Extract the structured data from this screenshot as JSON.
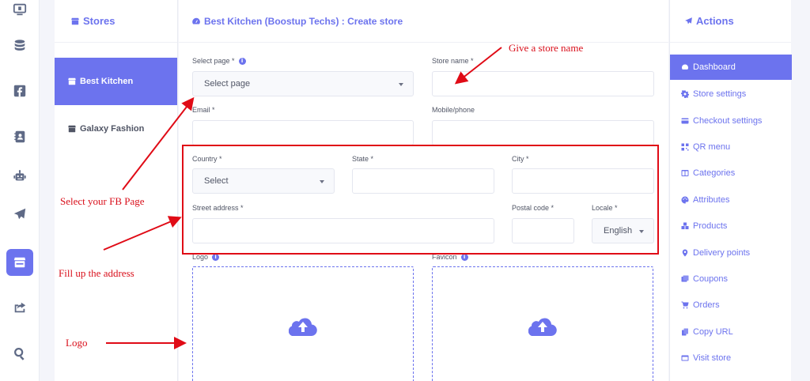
{
  "rail": {
    "items": [
      {
        "icon": "monitor-icon"
      },
      {
        "icon": "database-icon"
      },
      {
        "icon": "facebook-icon"
      },
      {
        "icon": "contact-book-icon"
      },
      {
        "icon": "robot-icon"
      },
      {
        "icon": "paper-plane-icon"
      },
      {
        "icon": "store-icon",
        "active": true
      },
      {
        "icon": "share-icon"
      },
      {
        "icon": "search-icon"
      }
    ]
  },
  "stores": {
    "title": "Stores",
    "items": [
      {
        "label": "Best Kitchen",
        "active": true
      },
      {
        "label": "Galaxy Fashion"
      }
    ]
  },
  "form": {
    "title": "Best Kitchen (Boostup Techs) : Create store",
    "select_page_label": "Select page *",
    "select_page_value": "Select page",
    "store_name_label": "Store name *",
    "store_name_value": "",
    "email_label": "Email *",
    "email_value": "",
    "mobile_label": "Mobile/phone",
    "mobile_value": "",
    "country_label": "Country *",
    "country_value": "Select",
    "state_label": "State *",
    "state_value": "",
    "city_label": "City *",
    "city_value": "",
    "street_label": "Street address *",
    "street_value": "",
    "postal_label": "Postal code *",
    "postal_value": "",
    "locale_label": "Locale *",
    "locale_value": "English",
    "logo_label": "Logo",
    "favicon_label": "Favicon"
  },
  "actions": {
    "title": "Actions",
    "items": [
      {
        "label": "Dashboard",
        "icon": "dashboard-icon",
        "active": true
      },
      {
        "label": "Store settings",
        "icon": "gear-icon"
      },
      {
        "label": "Checkout settings",
        "icon": "credit-card-icon"
      },
      {
        "label": "QR menu",
        "icon": "qr-code-icon"
      },
      {
        "label": "Categories",
        "icon": "columns-icon"
      },
      {
        "label": "Attributes",
        "icon": "palette-icon"
      },
      {
        "label": "Products",
        "icon": "boxes-icon"
      },
      {
        "label": "Delivery points",
        "icon": "map-marker-icon"
      },
      {
        "label": "Coupons",
        "icon": "coupons-icon"
      },
      {
        "label": "Orders",
        "icon": "cart-icon"
      },
      {
        "label": "Copy URL",
        "icon": "copy-icon"
      },
      {
        "label": "Visit store",
        "icon": "window-icon"
      }
    ]
  },
  "annotations": {
    "store_name_note": "Give a store name",
    "fb_page_note": "Select your FB Page",
    "address_note": "Fill up the address",
    "logo_note": "Logo",
    "annotation_color": "#d9101c"
  },
  "colors": {
    "accent": "#6c73ee",
    "text": "#505565",
    "background": "#f4f5fa"
  }
}
